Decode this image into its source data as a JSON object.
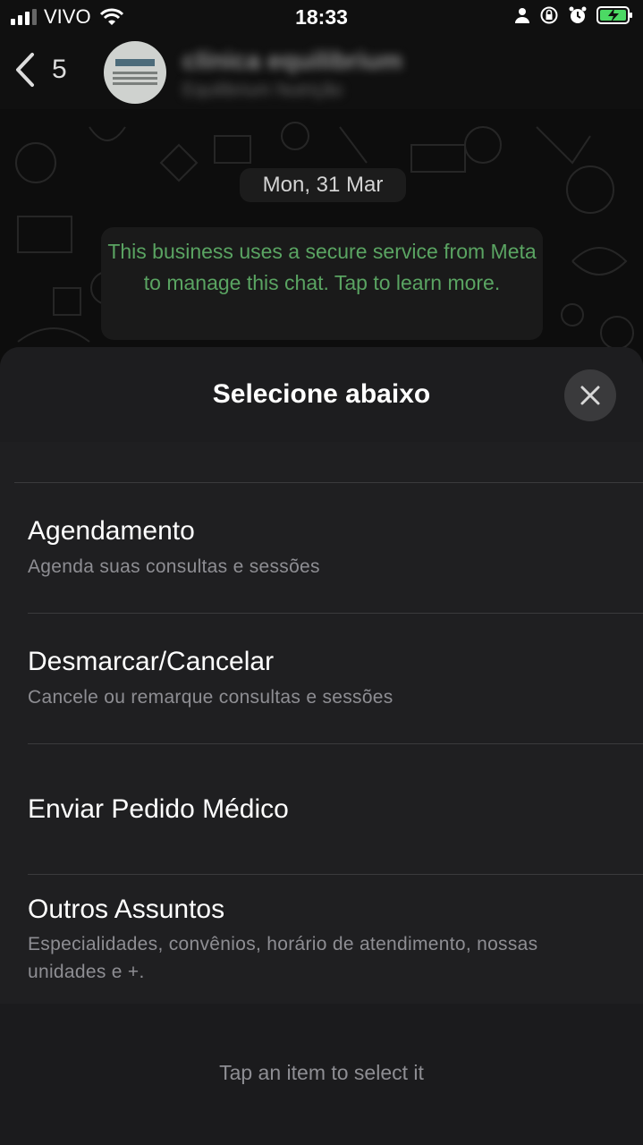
{
  "status_bar": {
    "carrier": "VIVO",
    "time": "18:33",
    "icons": [
      "signal-icon",
      "wifi-icon",
      "person-icon",
      "orientation-lock-icon",
      "alarm-icon",
      "battery-charging-icon"
    ]
  },
  "header": {
    "back_count": "5",
    "contact_name": "clínica equilibrium",
    "contact_subtitle": "Equilibrium Nutrição"
  },
  "chat": {
    "date": "Mon, 31 Mar",
    "system_message": "This business uses a secure service from Meta to manage this chat. Tap to learn more."
  },
  "sheet": {
    "title": "Selecione abaixo",
    "options": [
      {
        "title": "Agendamento",
        "description": "Agenda suas consultas e sessões"
      },
      {
        "title": "Desmarcar/Cancelar",
        "description": "Cancele ou remarque consultas e sessões"
      },
      {
        "title": "Enviar Pedido Médico",
        "description": ""
      },
      {
        "title": "Outros Assuntos",
        "description": "Especialidades, convênios, horário de atendimento, nossas unidades e +."
      }
    ],
    "footer_hint": "Tap an item to select it"
  },
  "colors": {
    "accent_green": "#5aa462",
    "sheet_bg": "#1f1f21",
    "separator": "#3a3a3c",
    "secondary_text": "#8e8e93"
  }
}
